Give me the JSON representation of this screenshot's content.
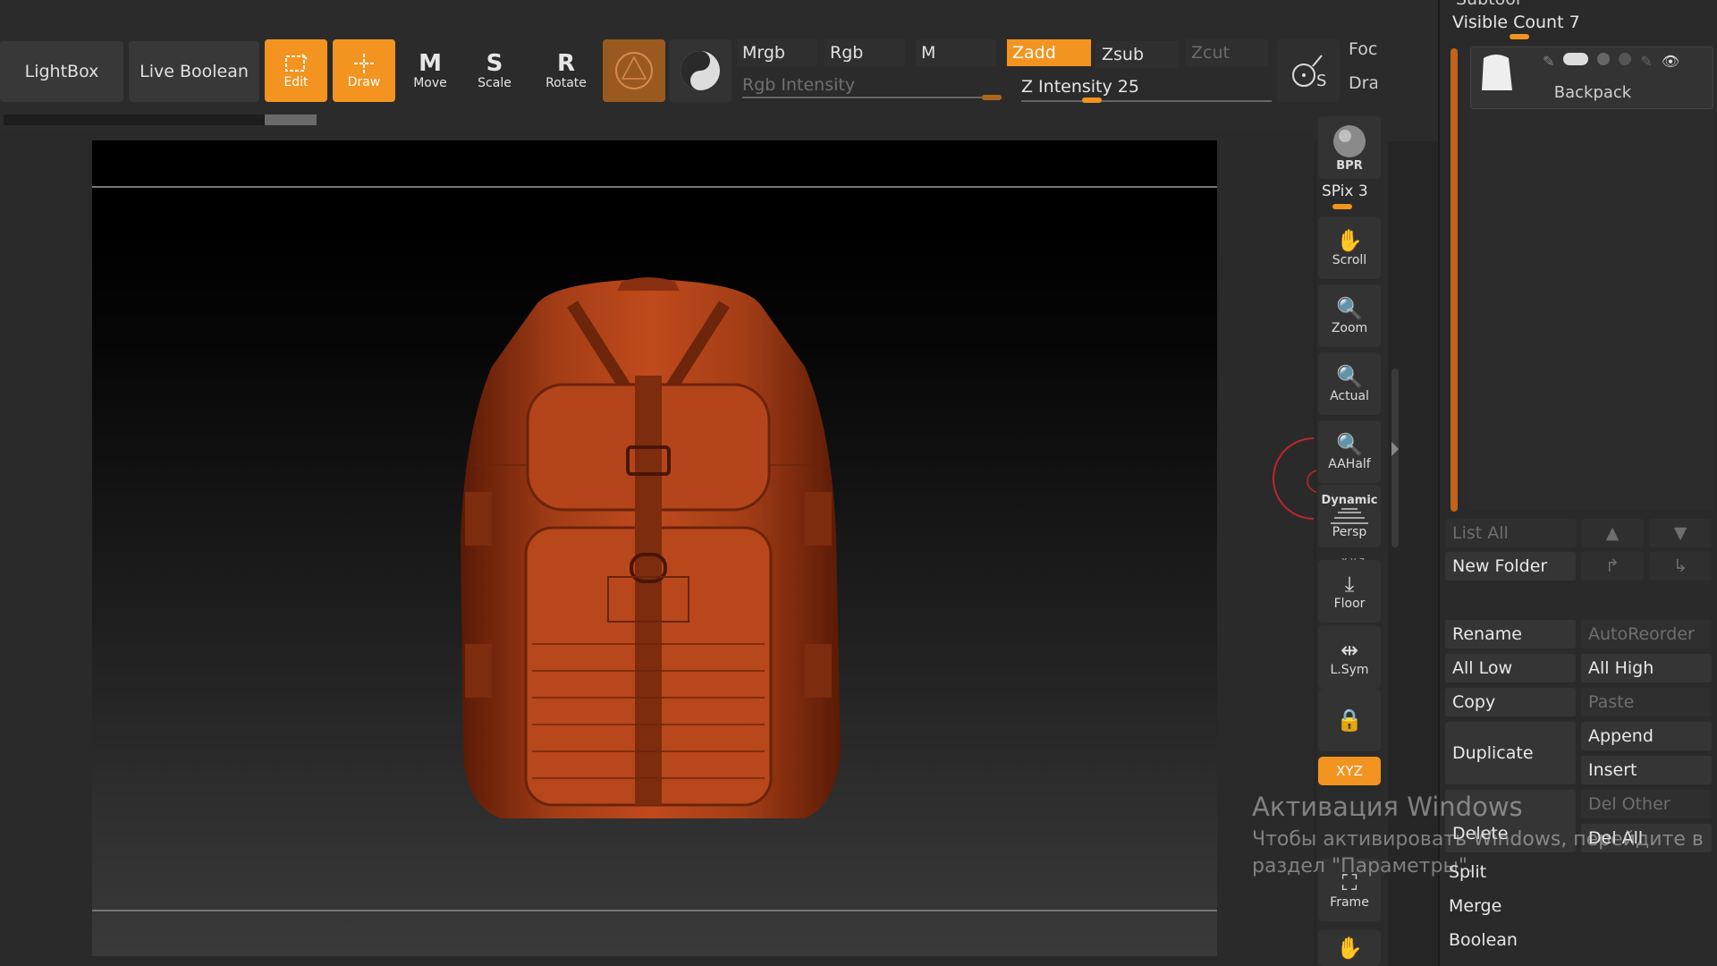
{
  "toolbar": {
    "lightbox": "LightBox",
    "live_boolean": "Live Boolean",
    "edit": "Edit",
    "draw": "Draw",
    "move": "Move",
    "scale": "Scale",
    "rotate": "Rotate",
    "move_glyph": "M",
    "scale_glyph": "S",
    "rotate_glyph": "R",
    "mrgb": "Mrgb",
    "rgb": "Rgb",
    "m": "M",
    "zadd": "Zadd",
    "zsub": "Zsub",
    "zcut": "Zcut",
    "rgb_intensity": "Rgb Intensity",
    "z_intensity": "Z Intensity 25",
    "z_intensity_value": 25,
    "focal": "Foca",
    "draw_size": "Drav",
    "s_glyph": "S"
  },
  "shelf": {
    "bpr": "BPR",
    "spix": "SPix 3",
    "scroll": "Scroll",
    "zoom": "Zoom",
    "actual": "Actual",
    "aahalf": "AAHalf",
    "dynamic": "Dynamic",
    "persp": "Persp",
    "floor": "Floor",
    "lsym": "L.Sym",
    "xyz": "XYZ",
    "frame": "Frame",
    "floor_axes": "x y z"
  },
  "subtool": {
    "header": "Subtool",
    "visible_count": "Visible Count 7",
    "item_name": "Backpack",
    "list_all": "List All",
    "new_folder": "New Folder",
    "rename": "Rename",
    "auto_reorder": "AutoReorder",
    "all_low": "All Low",
    "all_high": "All High",
    "copy": "Copy",
    "paste": "Paste",
    "duplicate": "Duplicate",
    "append": "Append",
    "insert": "Insert",
    "delete": "Delete",
    "del_other": "Del Other",
    "del_all": "Del All",
    "split": "Split",
    "merge": "Merge",
    "boolean": "Boolean"
  },
  "watermark": {
    "title": "Активация Windows",
    "line1": "Чтобы активировать Windows, перейдите в",
    "line2": "раздел \"Параметры\"."
  },
  "colors": {
    "accent": "#f2941f",
    "model": "#b8441a",
    "background": "#262626"
  }
}
